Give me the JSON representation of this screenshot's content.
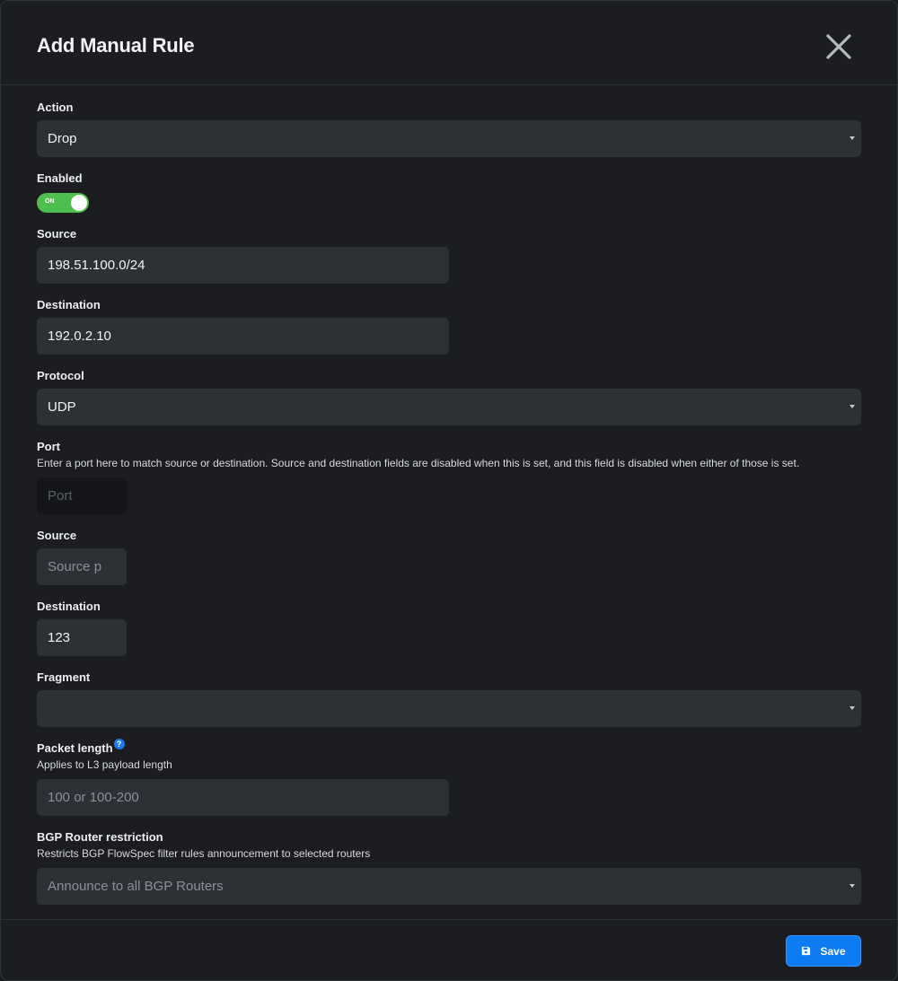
{
  "dialog": {
    "title": "Add Manual Rule",
    "save_label": "Save"
  },
  "fields": {
    "action": {
      "label": "Action",
      "value": "Drop"
    },
    "enabled": {
      "label": "Enabled",
      "toggle_text": "ON",
      "state": "on"
    },
    "source": {
      "label": "Source",
      "value": "198.51.100.0/24"
    },
    "destination": {
      "label": "Destination",
      "value": "192.0.2.10"
    },
    "protocol": {
      "label": "Protocol",
      "value": "UDP"
    },
    "port": {
      "label": "Port",
      "help": "Enter a port here to match source or destination. Source and destination fields are disabled when this is set, and this field is disabled when either of those is set.",
      "placeholder": "Port"
    },
    "source_port": {
      "label": "Source",
      "placeholder": "Source p"
    },
    "destination_port": {
      "label": "Destination",
      "value": "123"
    },
    "fragment": {
      "label": "Fragment",
      "value": ""
    },
    "packet_length": {
      "label": "Packet length",
      "help": "Applies to L3 payload length",
      "placeholder": "100 or 100-200",
      "help_icon_glyph": "?"
    },
    "bgp_router_restriction": {
      "label": "BGP Router restriction",
      "help": "Restricts BGP FlowSpec filter rules announcement to selected routers",
      "placeholder": "Announce to all BGP Routers"
    }
  },
  "colors": {
    "background": "#1b1d21",
    "input": "#2d3035",
    "toggle_on": "#4ebe4e",
    "primary": "#0d7bf2"
  }
}
